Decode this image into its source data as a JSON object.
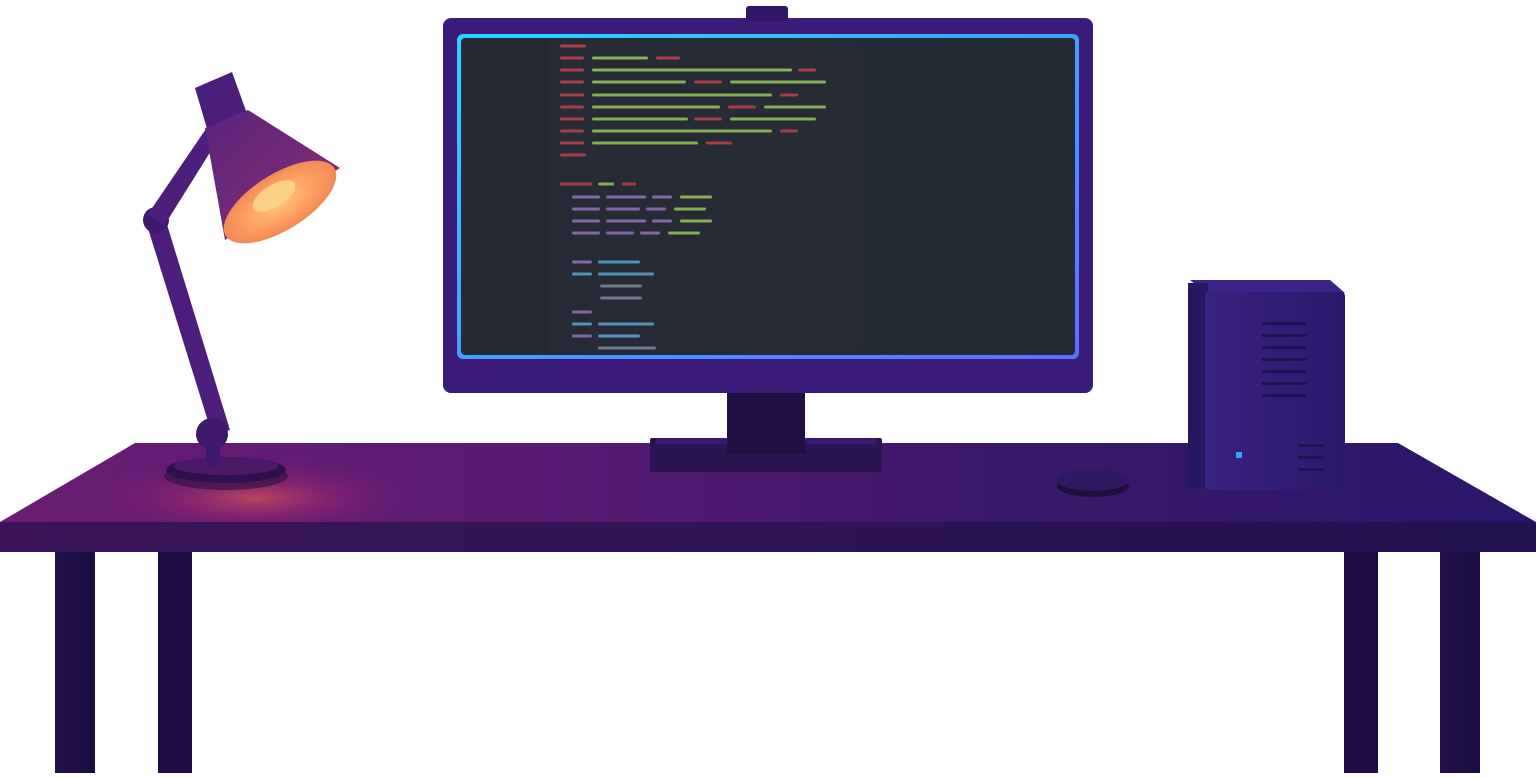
{
  "scene": {
    "subject": "desk-setup-illustration",
    "colors": {
      "background": "#ffffff",
      "desk_left": "#6a1a70",
      "desk_right": "#2b1666",
      "desk_front": "#2a1250",
      "legs": "#1e0d45",
      "monitor_frame": "#3b1b7a",
      "monitor_border_cyan": "#2ad6ff",
      "monitor_border_blue": "#5a6cff",
      "editor_bg": "#242a35",
      "gutter_bg": "#262b36",
      "lamp_body": "#4a1f78",
      "lamp_glow": "#ffb36a",
      "computer_case": "#2e1b6e",
      "power_led": "#3aa0ff",
      "code_red": "#b5404f",
      "code_green": "#8fbe58",
      "code_purple": "#8d6fb0",
      "code_blue": "#5aa0c8",
      "code_gray": "#7c8494"
    },
    "objects": [
      "desk",
      "desk-lamp",
      "monitor",
      "webcam",
      "code-editor-screen",
      "desktop-computer",
      "coaster"
    ]
  }
}
